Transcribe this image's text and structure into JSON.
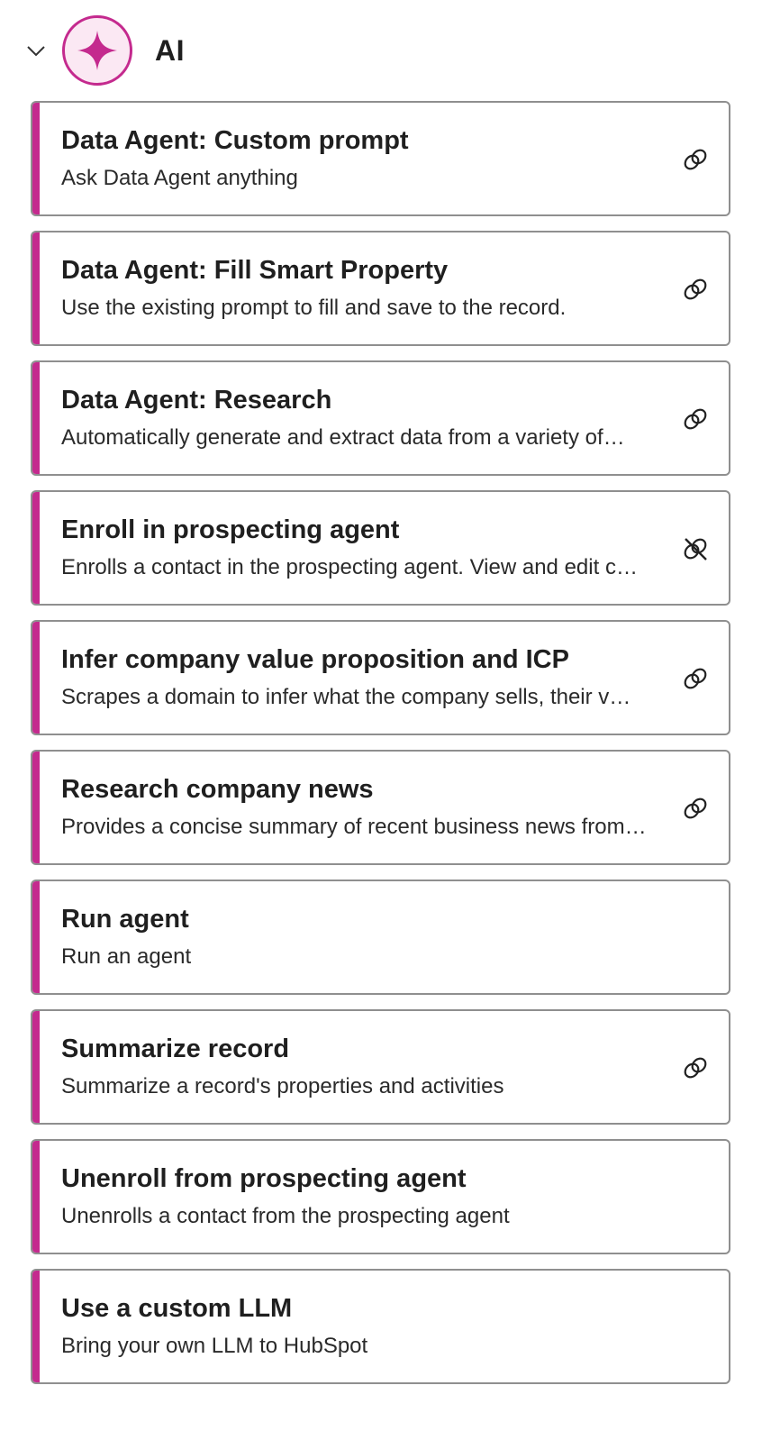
{
  "section": {
    "title": "AI",
    "collapsed": false,
    "accent_color": "#c42a8e",
    "badge_icon": "sparkle-icon"
  },
  "actions": [
    {
      "title": "Data Agent: Custom prompt",
      "description": "Ask Data Agent anything",
      "icon": "linked-icon"
    },
    {
      "title": "Data Agent: Fill Smart Property",
      "description": "Use the existing prompt to fill and save to the record.",
      "icon": "linked-icon"
    },
    {
      "title": "Data Agent: Research",
      "description": "Automatically generate and extract data from a variety of…",
      "icon": "linked-icon"
    },
    {
      "title": "Enroll in prospecting agent",
      "description": "Enrolls a contact in the prospecting agent. View and edit c…",
      "icon": "unlinked-icon"
    },
    {
      "title": "Infer company value proposition and ICP",
      "description": "Scrapes a domain to infer what the company sells, their v…",
      "icon": "linked-icon"
    },
    {
      "title": "Research company news",
      "description": "Provides a concise summary of recent business news from…",
      "icon": "linked-icon"
    },
    {
      "title": "Run agent",
      "description": "Run an agent",
      "icon": ""
    },
    {
      "title": "Summarize record",
      "description": "Summarize a record's properties and activities",
      "icon": "linked-icon"
    },
    {
      "title": "Unenroll from prospecting agent",
      "description": "Unenrolls a contact from the prospecting agent",
      "icon": ""
    },
    {
      "title": "Use a custom LLM",
      "description": "Bring your own LLM to HubSpot",
      "icon": ""
    }
  ]
}
